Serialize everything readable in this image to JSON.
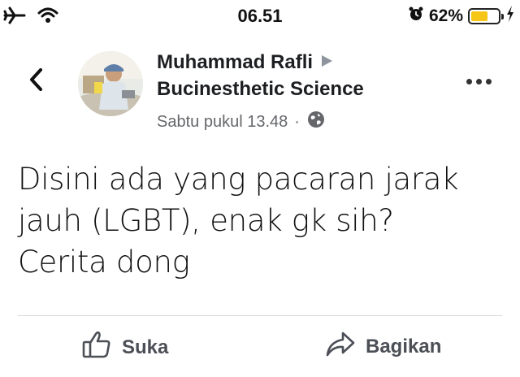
{
  "status_bar": {
    "time": "06.51",
    "battery_percent": "62%",
    "battery_level": 0.62,
    "icons": [
      "airplane-icon",
      "wifi-icon",
      "alarm-icon",
      "battery-icon",
      "charging-icon"
    ]
  },
  "header": {
    "author_name": "Muhammad Rafli",
    "group_name": "Bucinesthetic Science",
    "timestamp": "Sabtu pukul 13.48",
    "separator": "·"
  },
  "post": {
    "lines": [
      "Disini ada yang pacaran jarak",
      "jauh (LGBT), enak gk sih?",
      "Cerita dong"
    ]
  },
  "actions": {
    "like_label": "Suka",
    "share_label": "Bagikan"
  },
  "colors": {
    "battery_fill": "#f5c518",
    "secondary_text": "#65676b",
    "action_text": "#4b4f56"
  }
}
